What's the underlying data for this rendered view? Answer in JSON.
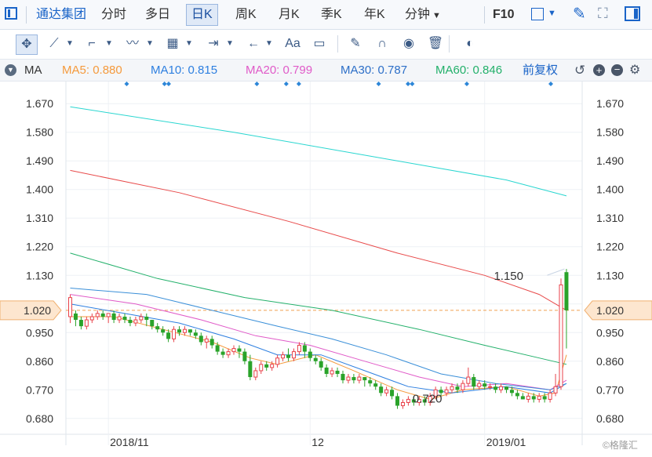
{
  "tabs": {
    "company": "通达集团",
    "intraday": "分时",
    "multi_day": "多日",
    "daily_k": "日K",
    "weekly_k": "周K",
    "monthly_k": "月K",
    "quarterly_k": "季K",
    "yearly_k": "年K",
    "minute": "分钟",
    "f10": "F10"
  },
  "toolbar": {
    "text_tool": "Aa"
  },
  "ma_legend": {
    "indicator": "MA",
    "ma5_label": "MA5:",
    "ma5_value": "0.880",
    "ma10_label": "MA10:",
    "ma10_value": "0.815",
    "ma20_label": "MA20:",
    "ma20_value": "0.799",
    "ma30_label": "MA30:",
    "ma30_value": "0.787",
    "ma60_label": "MA60:",
    "ma60_value": "0.846",
    "adjust": "前复权"
  },
  "colors": {
    "up": "#e8424a",
    "down": "#2aa32a",
    "ma5": "#f59a3c",
    "ma10": "#2d7fe0",
    "ma20": "#e05ac8",
    "ma30": "#3a8fd8",
    "ma60": "#22b06a",
    "ma120": "#e84a4a",
    "ma250": "#29d6d0",
    "reference": "#f0a050"
  },
  "watermark": "©格隆汇",
  "chart_data": {
    "type": "candlestick",
    "ylim": [
      0.64,
      1.71
    ],
    "yticks": [
      "1.670",
      "1.580",
      "1.490",
      "1.400",
      "1.310",
      "1.220",
      "1.130",
      "1.040",
      "0.950",
      "0.860",
      "0.770",
      "0.680"
    ],
    "xticks": [
      {
        "index": 7,
        "label": "2018/11"
      },
      {
        "index": 44,
        "label": "12"
      },
      {
        "index": 76,
        "label": "2019/01"
      }
    ],
    "current_price": "1.020",
    "annotations": {
      "high": "1.150",
      "low": "0.720"
    },
    "candles": [
      [
        1.0,
        1.06,
        1.07,
        0.98
      ],
      [
        1.01,
        0.99,
        1.02,
        0.97
      ],
      [
        0.99,
        0.97,
        1.0,
        0.96
      ],
      [
        0.97,
        0.99,
        1.0,
        0.96
      ],
      [
        0.99,
        1.0,
        1.01,
        0.98
      ],
      [
        1.0,
        1.01,
        1.02,
        0.99
      ],
      [
        1.01,
        1.0,
        1.02,
        0.99
      ],
      [
        1.0,
        1.01,
        1.01,
        0.98
      ],
      [
        1.01,
        0.99,
        1.02,
        0.98
      ],
      [
        0.99,
        1.0,
        1.01,
        0.98
      ],
      [
        1.0,
        0.99,
        1.01,
        0.98
      ],
      [
        0.99,
        0.98,
        1.0,
        0.97
      ],
      [
        0.98,
        0.99,
        1.0,
        0.97
      ],
      [
        0.99,
        1.0,
        1.01,
        0.98
      ],
      [
        1.0,
        0.99,
        1.01,
        0.97
      ],
      [
        0.99,
        0.97,
        0.99,
        0.96
      ],
      [
        0.97,
        0.96,
        0.98,
        0.95
      ],
      [
        0.96,
        0.95,
        0.97,
        0.94
      ],
      [
        0.95,
        0.93,
        0.96,
        0.92
      ],
      [
        0.93,
        0.96,
        0.97,
        0.92
      ],
      [
        0.96,
        0.95,
        0.97,
        0.94
      ],
      [
        0.95,
        0.96,
        0.97,
        0.94
      ],
      [
        0.96,
        0.95,
        0.96,
        0.94
      ],
      [
        0.95,
        0.94,
        0.96,
        0.93
      ],
      [
        0.94,
        0.92,
        0.95,
        0.91
      ],
      [
        0.92,
        0.93,
        0.94,
        0.9
      ],
      [
        0.93,
        0.91,
        0.94,
        0.9
      ],
      [
        0.91,
        0.89,
        0.92,
        0.88
      ],
      [
        0.89,
        0.88,
        0.9,
        0.87
      ],
      [
        0.88,
        0.89,
        0.9,
        0.87
      ],
      [
        0.89,
        0.9,
        0.91,
        0.88
      ],
      [
        0.9,
        0.89,
        0.91,
        0.87
      ],
      [
        0.89,
        0.86,
        0.9,
        0.85
      ],
      [
        0.86,
        0.81,
        0.88,
        0.8
      ],
      [
        0.81,
        0.83,
        0.84,
        0.8
      ],
      [
        0.83,
        0.85,
        0.86,
        0.82
      ],
      [
        0.85,
        0.84,
        0.86,
        0.83
      ],
      [
        0.84,
        0.85,
        0.86,
        0.83
      ],
      [
        0.85,
        0.87,
        0.88,
        0.84
      ],
      [
        0.87,
        0.88,
        0.89,
        0.86
      ],
      [
        0.88,
        0.87,
        0.9,
        0.86
      ],
      [
        0.87,
        0.89,
        0.9,
        0.86
      ],
      [
        0.89,
        0.91,
        0.92,
        0.88
      ],
      [
        0.91,
        0.89,
        0.92,
        0.87
      ],
      [
        0.89,
        0.87,
        0.9,
        0.86
      ],
      [
        0.87,
        0.86,
        0.88,
        0.85
      ],
      [
        0.86,
        0.84,
        0.87,
        0.83
      ],
      [
        0.84,
        0.82,
        0.85,
        0.81
      ],
      [
        0.82,
        0.83,
        0.84,
        0.81
      ],
      [
        0.83,
        0.82,
        0.84,
        0.81
      ],
      [
        0.82,
        0.8,
        0.83,
        0.79
      ],
      [
        0.8,
        0.81,
        0.82,
        0.79
      ],
      [
        0.81,
        0.8,
        0.82,
        0.79
      ],
      [
        0.8,
        0.81,
        0.82,
        0.79
      ],
      [
        0.81,
        0.8,
        0.81,
        0.78
      ],
      [
        0.8,
        0.79,
        0.81,
        0.78
      ],
      [
        0.79,
        0.78,
        0.8,
        0.77
      ],
      [
        0.78,
        0.76,
        0.79,
        0.75
      ],
      [
        0.76,
        0.77,
        0.78,
        0.75
      ],
      [
        0.77,
        0.75,
        0.78,
        0.74
      ],
      [
        0.75,
        0.72,
        0.76,
        0.71
      ],
      [
        0.72,
        0.73,
        0.74,
        0.71
      ],
      [
        0.73,
        0.74,
        0.75,
        0.72
      ],
      [
        0.74,
        0.73,
        0.75,
        0.72
      ],
      [
        0.73,
        0.74,
        0.75,
        0.72
      ],
      [
        0.74,
        0.73,
        0.75,
        0.72
      ],
      [
        0.73,
        0.75,
        0.76,
        0.72
      ],
      [
        0.75,
        0.77,
        0.78,
        0.74
      ],
      [
        0.77,
        0.76,
        0.78,
        0.75
      ],
      [
        0.76,
        0.77,
        0.78,
        0.75
      ],
      [
        0.77,
        0.78,
        0.79,
        0.76
      ],
      [
        0.78,
        0.77,
        0.79,
        0.76
      ],
      [
        0.77,
        0.79,
        0.8,
        0.76
      ],
      [
        0.79,
        0.81,
        0.84,
        0.78
      ],
      [
        0.81,
        0.78,
        0.82,
        0.77
      ],
      [
        0.78,
        0.79,
        0.8,
        0.77
      ],
      [
        0.79,
        0.78,
        0.8,
        0.77
      ],
      [
        0.78,
        0.78,
        0.79,
        0.77
      ],
      [
        0.78,
        0.77,
        0.79,
        0.76
      ],
      [
        0.77,
        0.78,
        0.79,
        0.76
      ],
      [
        0.78,
        0.77,
        0.78,
        0.76
      ],
      [
        0.77,
        0.76,
        0.78,
        0.75
      ],
      [
        0.76,
        0.75,
        0.77,
        0.74
      ],
      [
        0.75,
        0.74,
        0.76,
        0.74
      ],
      [
        0.74,
        0.75,
        0.76,
        0.73
      ],
      [
        0.75,
        0.74,
        0.76,
        0.73
      ],
      [
        0.74,
        0.75,
        0.76,
        0.73
      ],
      [
        0.75,
        0.74,
        0.76,
        0.73
      ],
      [
        0.74,
        0.76,
        0.77,
        0.73
      ],
      [
        0.76,
        0.78,
        0.82,
        0.75
      ],
      [
        0.78,
        1.1,
        1.12,
        0.77
      ],
      [
        1.14,
        1.02,
        1.15,
        0.9
      ]
    ],
    "ma_series": [
      {
        "name": "MA5",
        "color_key": "ma5",
        "values": [
          [
            0,
            1.0
          ],
          [
            8,
            1.0
          ],
          [
            17,
            0.96
          ],
          [
            26,
            0.92
          ],
          [
            33,
            0.87
          ],
          [
            38,
            0.85
          ],
          [
            45,
            0.88
          ],
          [
            52,
            0.83
          ],
          [
            60,
            0.77
          ],
          [
            66,
            0.74
          ],
          [
            72,
            0.77
          ],
          [
            80,
            0.78
          ],
          [
            86,
            0.75
          ],
          [
            89,
            0.76
          ],
          [
            90,
            0.82
          ],
          [
            91,
            0.88
          ]
        ]
      },
      {
        "name": "MA10",
        "color_key": "ma10",
        "values": [
          [
            0,
            1.04
          ],
          [
            10,
            1.01
          ],
          [
            20,
            0.98
          ],
          [
            30,
            0.93
          ],
          [
            38,
            0.88
          ],
          [
            46,
            0.88
          ],
          [
            54,
            0.83
          ],
          [
            62,
            0.78
          ],
          [
            70,
            0.76
          ],
          [
            80,
            0.78
          ],
          [
            88,
            0.76
          ],
          [
            91,
            0.79
          ]
        ]
      },
      {
        "name": "MA20",
        "color_key": "ma20",
        "values": [
          [
            0,
            1.07
          ],
          [
            12,
            1.04
          ],
          [
            24,
            0.99
          ],
          [
            34,
            0.94
          ],
          [
            44,
            0.91
          ],
          [
            54,
            0.86
          ],
          [
            64,
            0.81
          ],
          [
            72,
            0.78
          ],
          [
            80,
            0.79
          ],
          [
            88,
            0.77
          ],
          [
            91,
            0.8
          ]
        ]
      },
      {
        "name": "MA30",
        "color_key": "ma30",
        "values": [
          [
            0,
            1.09
          ],
          [
            14,
            1.07
          ],
          [
            26,
            1.02
          ],
          [
            38,
            0.97
          ],
          [
            48,
            0.93
          ],
          [
            58,
            0.88
          ],
          [
            68,
            0.82
          ],
          [
            78,
            0.79
          ],
          [
            88,
            0.77
          ],
          [
            91,
            0.79
          ]
        ]
      },
      {
        "name": "MA60",
        "color_key": "ma60",
        "values": [
          [
            0,
            1.2
          ],
          [
            16,
            1.12
          ],
          [
            32,
            1.06
          ],
          [
            48,
            1.02
          ],
          [
            64,
            0.96
          ],
          [
            76,
            0.91
          ],
          [
            86,
            0.87
          ],
          [
            91,
            0.85
          ]
        ]
      },
      {
        "name": "MA120",
        "color_key": "ma120",
        "values": [
          [
            0,
            1.46
          ],
          [
            20,
            1.39
          ],
          [
            40,
            1.3
          ],
          [
            60,
            1.2
          ],
          [
            76,
            1.13
          ],
          [
            86,
            1.07
          ],
          [
            91,
            1.02
          ]
        ]
      },
      {
        "name": "MA250",
        "color_key": "ma250",
        "values": [
          [
            0,
            1.66
          ],
          [
            30,
            1.58
          ],
          [
            60,
            1.49
          ],
          [
            80,
            1.43
          ],
          [
            91,
            1.38
          ]
        ]
      }
    ],
    "event_markers": [
      7,
      16,
      17,
      38,
      45,
      48,
      67,
      74,
      75,
      88,
      108
    ],
    "event_marker_max": 108
  }
}
